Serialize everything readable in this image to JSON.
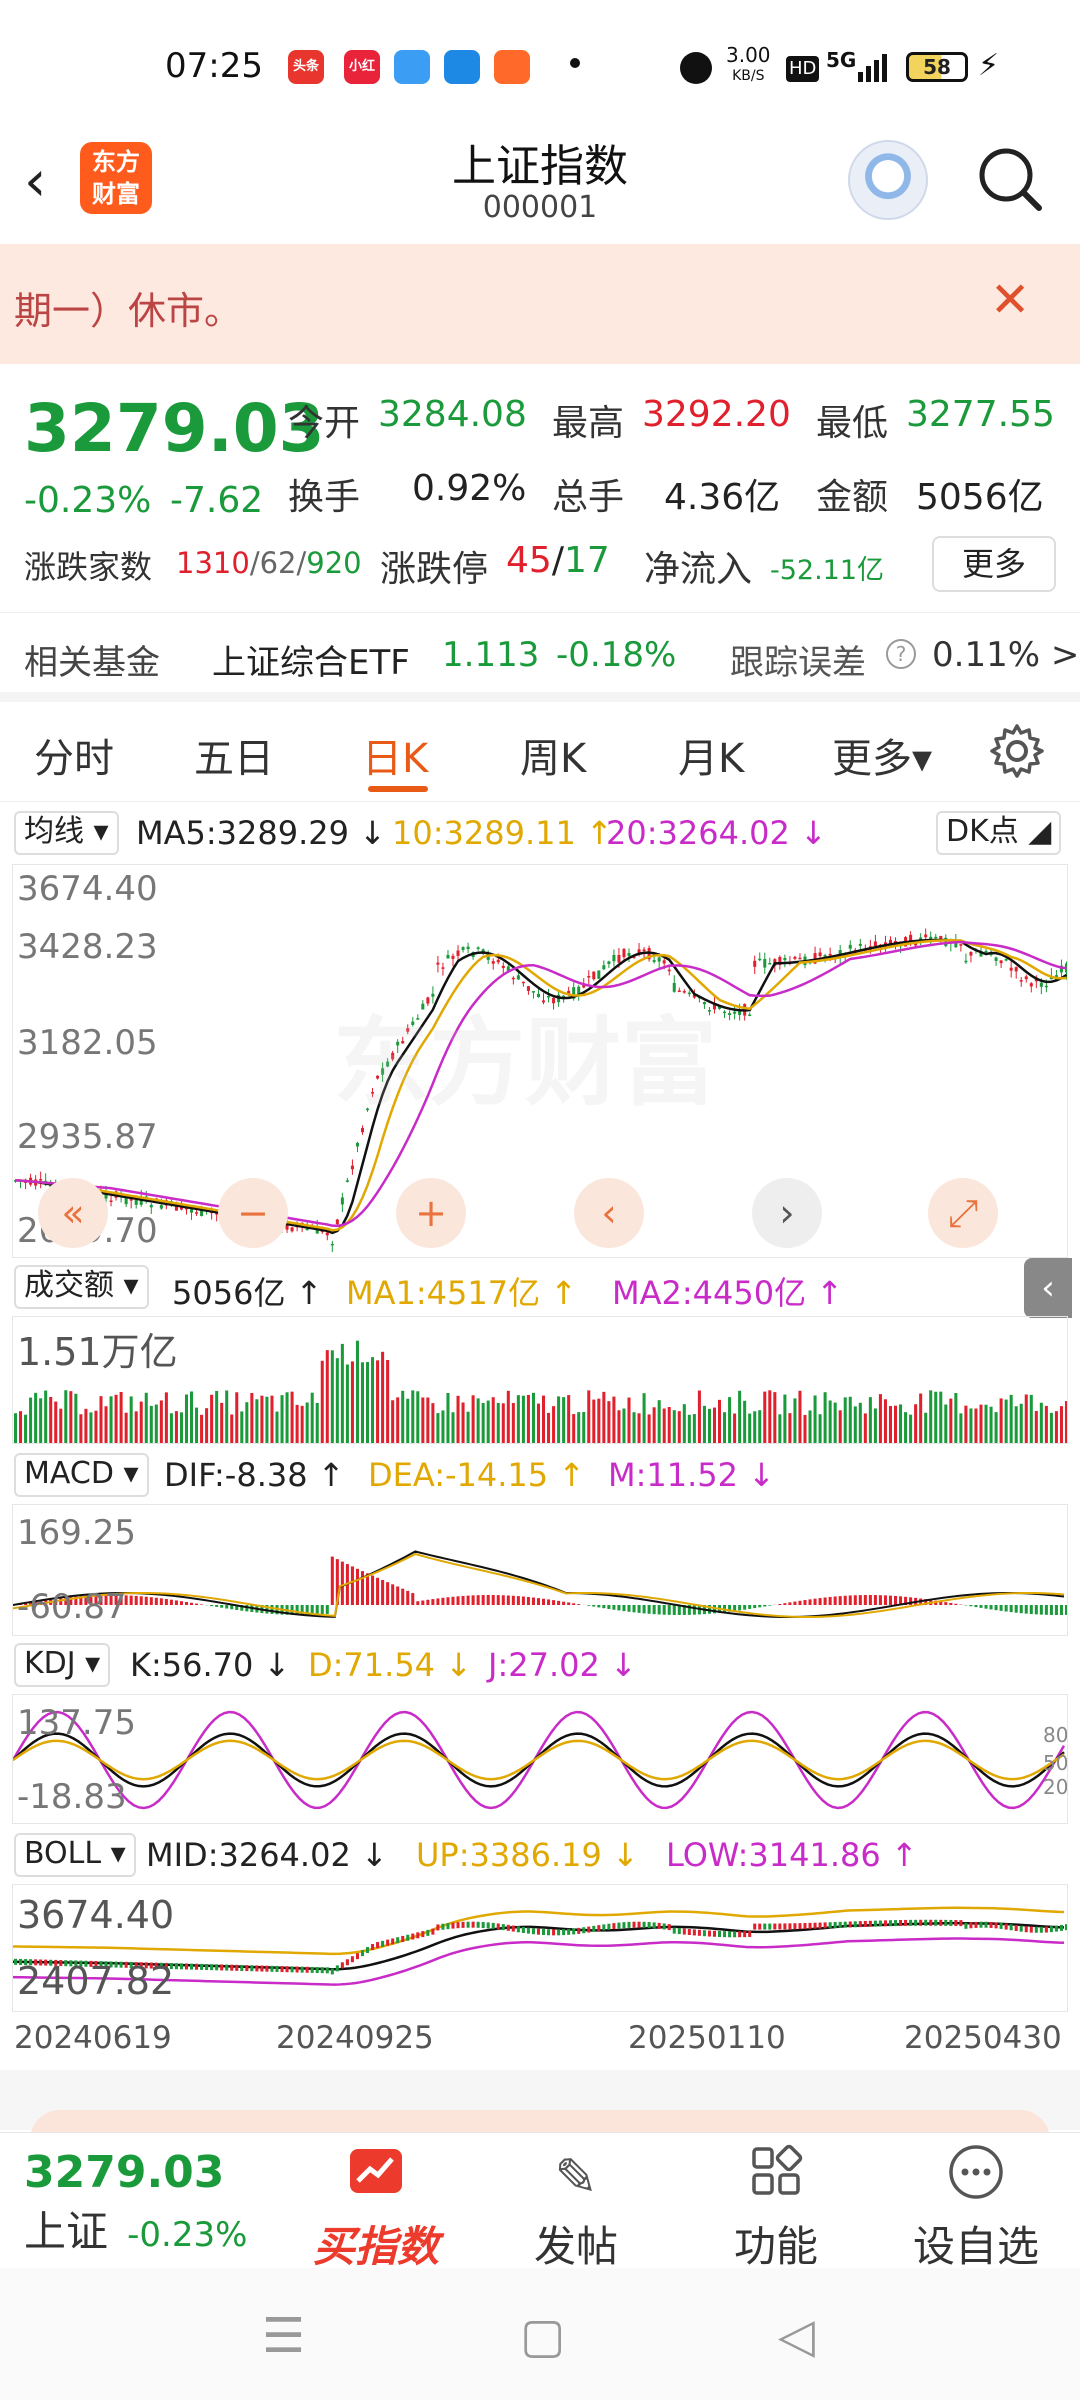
{
  "status": {
    "time": "07:25",
    "apps": [
      "头条",
      "小红书",
      "",
      "",
      "",
      ""
    ],
    "net_speed_top": "3.00",
    "net_speed_unit": "KB/S",
    "hd": "HD",
    "network": "5G",
    "battery": "58"
  },
  "header": {
    "logo_line1": "东方",
    "logo_line2": "财富",
    "title": "上证指数",
    "code": "000001"
  },
  "notice": {
    "text": "期一）休市。"
  },
  "quote": {
    "price": "3279.03",
    "change_pct": "-0.23%",
    "change": "-7.62",
    "open_label": "今开",
    "open": "3284.08",
    "high_label": "最高",
    "high": "3292.20",
    "low_label": "最低",
    "low": "3277.55",
    "turnover_label": "换手",
    "turnover": "0.92%",
    "volume_label": "总手",
    "volume": "4.36亿",
    "amount_label": "金额",
    "amount": "5056亿",
    "breadth_label": "涨跌家数",
    "up_count": "1310",
    "flat_count": "/62/",
    "down_count": "920",
    "limit_label": "涨跌停",
    "limit_up": "45",
    "limit_sep": "/",
    "limit_down": "17",
    "inflow_label": "净流入",
    "inflow": "-52.11亿",
    "more_label": "更多"
  },
  "fund": {
    "label": "相关基金",
    "name": "上证综合ETF",
    "price": "1.113",
    "change": "-0.18%",
    "tracking_label": "跟踪误差",
    "tracking_value": "0.11% >"
  },
  "tabs": [
    "分时",
    "五日",
    "日K",
    "周K",
    "月K",
    "更多▾"
  ],
  "active_tab": "日K",
  "ma_row": {
    "selector": "均线 ▾",
    "ma5": "MA5:3289.29 ↓",
    "ma10": "10:3289.11 ↑",
    "ma20": "20:3264.02 ↓",
    "dk": "DK点 ◢"
  },
  "kline_axis": [
    "3674.40",
    "3428.23",
    "3182.05",
    "2935.87",
    "2689.70"
  ],
  "volume_row": {
    "selector": "成交额 ▾",
    "value": "5056亿 ↑",
    "ma1": "MA1:4517亿 ↑",
    "ma2": "MA2:4450亿 ↑",
    "axis_top": "1.51万亿"
  },
  "macd_row": {
    "selector": "MACD ▾",
    "dif": "DIF:-8.38 ↑",
    "dea": "DEA:-14.15 ↑",
    "m": "M:11.52 ↓",
    "axis_top": "169.25",
    "axis_bottom": "-60.87"
  },
  "kdj_row": {
    "selector": "KDJ ▾",
    "k": "K:56.70 ↓",
    "d": "D:71.54 ↓",
    "j": "J:27.02 ↓",
    "axis_top": "137.75",
    "axis_bottom": "-18.83",
    "ref_80": "80",
    "ref_50": "50",
    "ref_20": "20"
  },
  "boll_row": {
    "selector": "BOLL ▾",
    "mid": "MID:3264.02 ↓",
    "up": "UP:3386.19 ↓",
    "low": "LOW:3141.86 ↑",
    "axis_top": "3674.40",
    "axis_bottom": "2407.82"
  },
  "dates": [
    "20240619",
    "20240925",
    "20250110",
    "20250430"
  ],
  "watermark": "东方财富",
  "bottom": {
    "price": "3279.03",
    "name": "上证",
    "change": "-0.23%",
    "buy_label": "买指数",
    "post_label": "发帖",
    "func_label": "功能",
    "watch_label": "设自选"
  },
  "colors": {
    "up": "#e0202d",
    "down": "#1a9a3a",
    "accent": "#e85a16",
    "ma10": "#e0a800",
    "ma20": "#c82bc8"
  },
  "chart_data": [
    {
      "type": "candlestick",
      "title": "日K",
      "x": [
        "20240619",
        "20240925",
        "20250110",
        "20250430"
      ],
      "ylim": [
        2689.7,
        3674.4
      ],
      "series": [
        {
          "name": "MA5",
          "last": 3289.29
        },
        {
          "name": "MA10",
          "last": 3289.11
        },
        {
          "name": "MA20",
          "last": 3264.02
        }
      ]
    },
    {
      "type": "bar",
      "title": "成交额",
      "ylim_top": "1.51万亿",
      "series": [
        {
          "name": "成交额",
          "last": "5056亿"
        },
        {
          "name": "MA1",
          "last": "4517亿"
        },
        {
          "name": "MA2",
          "last": "4450亿"
        }
      ]
    },
    {
      "type": "bar",
      "title": "MACD",
      "ylim": [
        -60.87,
        169.25
      ],
      "series": [
        {
          "name": "DIF",
          "last": -8.38
        },
        {
          "name": "DEA",
          "last": -14.15
        },
        {
          "name": "M",
          "last": 11.52
        }
      ]
    },
    {
      "type": "line",
      "title": "KDJ",
      "ylim": [
        -18.83,
        137.75
      ],
      "series": [
        {
          "name": "K",
          "last": 56.7
        },
        {
          "name": "D",
          "last": 71.54
        },
        {
          "name": "J",
          "last": 27.02
        }
      ]
    },
    {
      "type": "line",
      "title": "BOLL",
      "ylim": [
        2407.82,
        3674.4
      ],
      "series": [
        {
          "name": "MID",
          "last": 3264.02
        },
        {
          "name": "UP",
          "last": 3386.19
        },
        {
          "name": "LOW",
          "last": 3141.86
        }
      ]
    }
  ]
}
